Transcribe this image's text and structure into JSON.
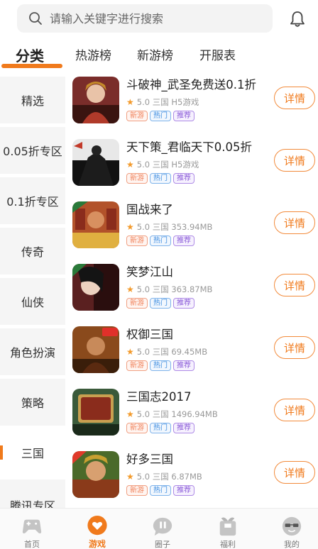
{
  "search": {
    "placeholder": "请输入关键字进行搜索"
  },
  "tabs": [
    {
      "label": "分类"
    },
    {
      "label": "热游榜"
    },
    {
      "label": "新游榜"
    },
    {
      "label": "开服表"
    }
  ],
  "sidebar": {
    "items": [
      {
        "label": "精选"
      },
      {
        "label": "0.05折专区"
      },
      {
        "label": "0.1折专区"
      },
      {
        "label": "传奇"
      },
      {
        "label": "仙侠"
      },
      {
        "label": "角色扮演"
      },
      {
        "label": "策略"
      },
      {
        "label": "三国"
      },
      {
        "label": "腾讯专区"
      }
    ],
    "active": "三国"
  },
  "games": [
    {
      "name": "斗破神_武圣免费送0.1折",
      "rating": "5.0",
      "category": "三国",
      "info": "H5游戏",
      "tags": [
        "新游",
        "热门",
        "推荐"
      ],
      "button": "详情",
      "thumb_color": "#7a2d2a"
    },
    {
      "name": "天下策_君临天下0.05折",
      "rating": "5.0",
      "category": "三国",
      "info": "H5游戏",
      "tags": [
        "新游",
        "热门",
        "推荐"
      ],
      "button": "详情",
      "thumb_color": "#1a1a1a"
    },
    {
      "name": "国战来了",
      "rating": "5.0",
      "category": "三国",
      "info": "353.94MB",
      "tags": [
        "新游",
        "热门",
        "推荐"
      ],
      "button": "详情",
      "thumb_color": "#b2522a"
    },
    {
      "name": "笑梦江山",
      "rating": "5.0",
      "category": "三国",
      "info": "363.87MB",
      "tags": [
        "新游",
        "热门",
        "推荐"
      ],
      "button": "详情",
      "thumb_color": "#5a2020"
    },
    {
      "name": "权御三国",
      "rating": "5.0",
      "category": "三国",
      "info": "69.45MB",
      "tags": [
        "新游",
        "热门",
        "推荐"
      ],
      "button": "详情",
      "thumb_color": "#8a4a1c"
    },
    {
      "name": "三国志2017",
      "rating": "5.0",
      "category": "三国",
      "info": "1496.94MB",
      "tags": [
        "新游",
        "热门",
        "推荐"
      ],
      "button": "详情",
      "thumb_color": "#3a5a3a"
    },
    {
      "name": "好多三国",
      "rating": "5.0",
      "category": "三国",
      "info": "6.87MB",
      "tags": [
        "新游",
        "热门",
        "推荐"
      ],
      "button": "详情",
      "thumb_color": "#4a6a2a"
    }
  ],
  "bottom_nav": [
    {
      "label": "首页",
      "icon": "gamepad-icon"
    },
    {
      "label": "游戏",
      "icon": "game-heart-icon",
      "active": true
    },
    {
      "label": "圈子",
      "icon": "chat-bubble-icon"
    },
    {
      "label": "福利",
      "icon": "gift-icon"
    },
    {
      "label": "我的",
      "icon": "profile-glasses-icon"
    }
  ],
  "colors": {
    "accent": "#f07a1c",
    "tag_new": "#f0825b",
    "tag_hot": "#3f8de0",
    "tag_rec": "#8a5bd8"
  }
}
